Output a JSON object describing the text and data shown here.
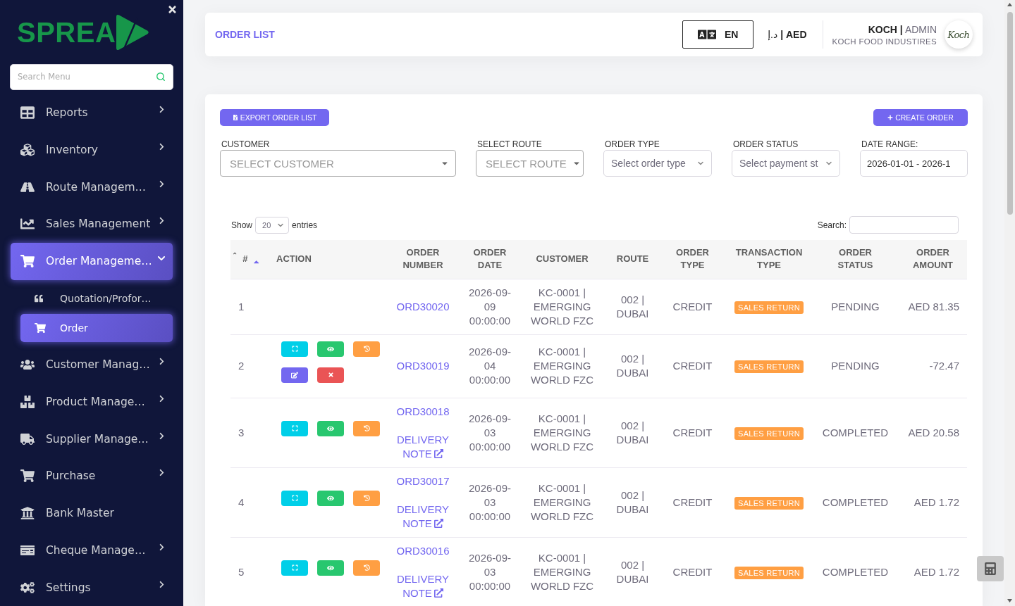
{
  "sidebar": {
    "brand": "SPREA",
    "search": {
      "placeholder": "Search Menu"
    },
    "items": [
      {
        "label": "Reports",
        "kind": "group",
        "expanded": false,
        "selected": false
      },
      {
        "label": "Inventory",
        "kind": "group",
        "expanded": false,
        "selected": false
      },
      {
        "label": "Route Managem…",
        "kind": "group",
        "expanded": false,
        "selected": false
      },
      {
        "label": "Sales Management",
        "kind": "group",
        "expanded": false,
        "selected": false
      },
      {
        "label": "Order Manageme…",
        "kind": "group",
        "expanded": true,
        "selected": true,
        "children": [
          {
            "label": "Quotation/Profor…",
            "selected": false
          },
          {
            "label": "Order",
            "selected": true
          }
        ]
      },
      {
        "label": "Customer Manag…",
        "kind": "group",
        "expanded": false,
        "selected": false
      },
      {
        "label": "Product Manage…",
        "kind": "group",
        "expanded": false,
        "selected": false
      },
      {
        "label": "Supplier Manage…",
        "kind": "group",
        "expanded": false,
        "selected": false
      },
      {
        "label": "Purchase",
        "kind": "group",
        "expanded": false,
        "selected": false
      },
      {
        "label": "Bank Master",
        "kind": "link",
        "selected": false
      },
      {
        "label": "Cheque Manage…",
        "kind": "group",
        "expanded": false,
        "selected": false
      },
      {
        "label": "Settings",
        "kind": "group",
        "expanded": false,
        "selected": false
      }
    ]
  },
  "header": {
    "title": "ORDER LIST",
    "language": "EN",
    "currency": "د.إ **| AED**",
    "user": {
      "name": "**KOCH |** ADMIN",
      "company": "KOCH FOOD INDUSTIRES",
      "logo_text": "Koch"
    }
  },
  "toolbar": {
    "export_button": "EXPORT ORDER LIST",
    "create_button": "CREATE ORDER"
  },
  "filters": [
    {
      "label": "CUSTOMER",
      "kind": "combo",
      "placeholder": "SELECT CUSTOMER"
    },
    {
      "label": "SELECT ROUTE",
      "kind": "combo",
      "placeholder": "SELECT ROUTE"
    },
    {
      "label": "ORDER TYPE",
      "kind": "select",
      "placeholder": "Select order type"
    },
    {
      "label": "ORDER STATUS",
      "kind": "select",
      "placeholder": "Select payment st"
    },
    {
      "label": "DATE RANGE:",
      "kind": "date",
      "value": "2026-01-01 - 2026-1"
    }
  ],
  "table_controls": {
    "show_label": "Show",
    "page_size": "20",
    "entries_label": "entries",
    "search_label": "Search:"
  },
  "table": {
    "columns": [
      {
        "label": "#",
        "sorted": true
      },
      {
        "label": "ACTION",
        "sorted": false
      },
      {
        "label": "ORDER NUMBER",
        "sorted": false
      },
      {
        "label": "ORDER DATE",
        "sorted": false
      },
      {
        "label": "CUSTOMER",
        "sorted": false
      },
      {
        "label": "ROUTE",
        "sorted": false
      },
      {
        "label": "ORDER TYPE",
        "sorted": false
      },
      {
        "label": "TRANSACTION TYPE",
        "sorted": false
      },
      {
        "label": "ORDER STATUS",
        "sorted": false
      },
      {
        "label": "ORDER AMOUNT",
        "sorted": false
      }
    ],
    "rows": [
      {
        "number": "1",
        "order_number": "ORD30020",
        "date": "2026-09-09 00:00:00",
        "customer": "KC-0001 | EMERGING WORLD FZC",
        "route": "002 | DUBAI",
        "order_type": "CREDIT",
        "transaction_type": "SALES RETURN",
        "status": "PENDING",
        "amount": "AED 81.35"
      },
      {
        "number": "2",
        "actions": [
          {
            "kind": "expand"
          },
          {
            "kind": "view"
          },
          {
            "kind": "history"
          },
          {
            "kind": "edit"
          },
          {
            "kind": "delete"
          }
        ],
        "order_number": "ORD30019",
        "date": "2026-09-04 00:00:00",
        "customer": "KC-0001 | EMERGING WORLD FZC",
        "route": "002 | DUBAI",
        "order_type": "CREDIT",
        "transaction_type": "SALES RETURN",
        "status": "PENDING",
        "amount": "-72.47"
      },
      {
        "number": "3",
        "actions": [
          {
            "kind": "expand"
          },
          {
            "kind": "view"
          },
          {
            "kind": "history"
          }
        ],
        "order_number": "ORD30018",
        "delivery_note": "DELIVERY NOTE",
        "date": "2026-09-03 00:00:00",
        "customer": "KC-0001 | EMERGING WORLD FZC",
        "route": "002 | DUBAI",
        "order_type": "CREDIT",
        "transaction_type": "SALES RETURN",
        "status": "COMPLETED",
        "amount": "AED 20.58"
      },
      {
        "number": "4",
        "actions": [
          {
            "kind": "expand"
          },
          {
            "kind": "view"
          },
          {
            "kind": "history"
          }
        ],
        "order_number": "ORD30017",
        "delivery_note": "DELIVERY NOTE",
        "date": "2026-09-03 00:00:00",
        "customer": "KC-0001 | EMERGING WORLD FZC",
        "route": "002 | DUBAI",
        "order_type": "CREDIT",
        "transaction_type": "SALES RETURN",
        "status": "COMPLETED",
        "amount": "AED 1.72"
      },
      {
        "number": "5",
        "actions": [
          {
            "kind": "expand"
          },
          {
            "kind": "view"
          },
          {
            "kind": "history"
          }
        ],
        "order_number": "ORD30016",
        "delivery_note": "DELIVERY NOTE",
        "date": "2026-09-03 00:00:00",
        "customer": "KC-0001 | EMERGING WORLD FZC",
        "route": "002 | DUBAI",
        "order_type": "CREDIT",
        "transaction_type": "SALES RETURN",
        "status": "COMPLETED",
        "amount": "AED 1.72"
      }
    ]
  }
}
